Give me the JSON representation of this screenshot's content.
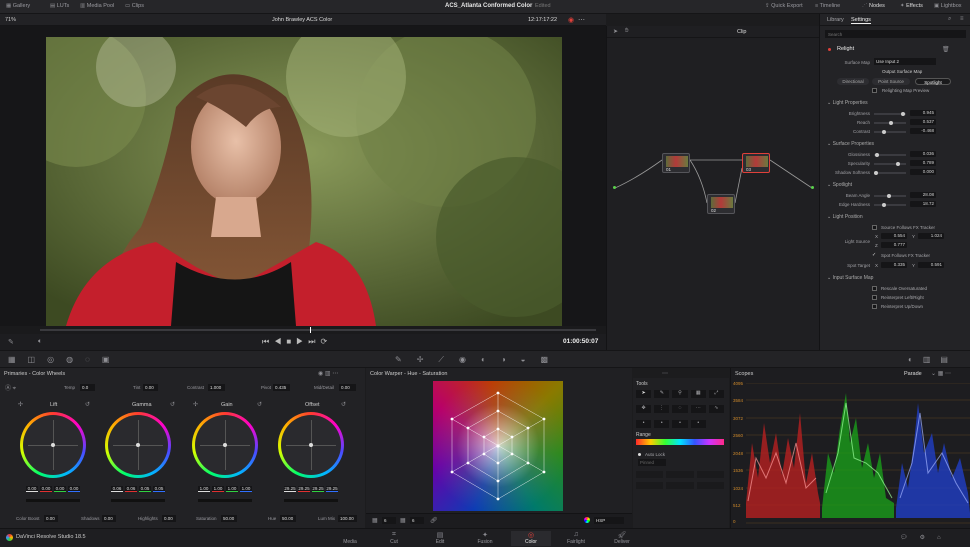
{
  "topbar": {
    "gallery": "Gallery",
    "luts": "LUTs",
    "media_pool": "Media Pool",
    "clips": "Clips",
    "project_title": "ACS_Atlanta Conformed Color",
    "edited": "Edited",
    "quick_export": "Quick Export",
    "timeline": "Timeline",
    "nodes": "Nodes",
    "effects": "Effects",
    "lightbox": "Lightbox"
  },
  "viewer": {
    "zoom": "71%",
    "clip_name": "John Brawley ACS Color",
    "timecode": "12:17:17:22",
    "clip_mode": "Clip",
    "playhead_tc": "01:00:50:07"
  },
  "inspector": {
    "tab_library": "Library",
    "tab_settings": "Settings",
    "search_placeholder": "Search",
    "effect_name": "Relight",
    "surface_map_label": "Surface Map",
    "surface_map_value": "Use Input 2",
    "output_surface_map": "Output Surface Map",
    "mode_directional": "Directional",
    "mode_point": "Point Source",
    "mode_spotlight": "Spotlight",
    "relighting_preview": "Relighting Map Preview",
    "light_properties": "Light Properties",
    "brightness_label": "Brightness",
    "brightness": "0.945",
    "brightness_pct": 0.95,
    "reach_label": "Reach",
    "reach": "0.537",
    "reach_pct": 0.54,
    "contrast_label": "Contrast",
    "contrast": "-0.468",
    "contrast_pct": 0.27,
    "surface_properties": "Surface Properties",
    "glossiness_label": "Glossiness",
    "glossiness": "0.036",
    "glossiness_pct": 0.04,
    "specularity_label": "Specularity",
    "specularity": "0.789",
    "specularity_pct": 0.79,
    "shadow_softness_label": "Shadow Softness",
    "shadow_softness": "0.000",
    "shadow_softness_pct": 0.0,
    "spotlight": "Spotlight",
    "beam_angle_label": "Beam Angle",
    "beam_angle": "28.08",
    "beam_angle_pct": 0.45,
    "edge_hardness_label": "Edge Hardness",
    "edge_hardness": "18.72",
    "edge_hardness_pct": 0.3,
    "light_position": "Light Position",
    "source_follows": "Source Follows FX Tracker",
    "light_source_label": "Light Source",
    "ls_x": "0.554",
    "ls_y": "1.024",
    "ls_z": "0.777",
    "spot_follows": "Spot Follows FX Tracker",
    "spot_target_label": "Spot Target",
    "st_x": "0.335",
    "st_y": "0.591",
    "input_surface_map": "Input Surface Map",
    "rescale": "Rescale Oversaturated",
    "reinterpret_lr": "Reinterpret Left/Right",
    "reinterpret_ud": "Reinterpret Up/Down",
    "x": "X",
    "y": "Y",
    "z": "Z"
  },
  "nodes": {
    "n01": "01",
    "n02": "02",
    "n03": "03"
  },
  "primaries": {
    "title": "Primaries - Color Wheels",
    "temp_label": "Temp",
    "temp": "0.0",
    "tint_label": "Tint",
    "tint": "0.00",
    "contrast_label": "Contrast",
    "contrast": "1.000",
    "pivot_label": "Pivot",
    "pivot": "0.435",
    "middetail_label": "Mid/Detail",
    "middetail": "0.00",
    "lift": "Lift",
    "lift_vals": [
      "0.00",
      "0.00",
      "0.00",
      "0.00"
    ],
    "gamma": "Gamma",
    "gamma_vals": [
      "0.06",
      "0.06",
      "0.05",
      "0.05"
    ],
    "gain": "Gain",
    "gain_vals": [
      "1.00",
      "1.00",
      "1.00",
      "1.00"
    ],
    "offset": "Offset",
    "offset_vals": [
      "29.25",
      "29.25",
      "29.25",
      "29.25"
    ],
    "color_boost_label": "Color Boost",
    "color_boost": "0.00",
    "shadows_label": "Shadows",
    "shadows": "0.00",
    "highlights_label": "Highlights",
    "highlights": "0.00",
    "saturation_label": "Saturation",
    "saturation": "50.00",
    "hue_label": "Hue",
    "hue": "50.00",
    "lummix_label": "Lum Mix",
    "lummix": "100.00"
  },
  "warper": {
    "title": "Color Warper - Hue - Saturation",
    "grid_a": "6",
    "grid_b": "6",
    "space": "HSP"
  },
  "tools": {
    "title": "Tools",
    "range": "Range",
    "auto_lock": "Auto Lock",
    "placeholder": "Pinned"
  },
  "scopes": {
    "title": "Scopes",
    "mode": "Parade",
    "ticks": [
      "4095",
      "3584",
      "3072",
      "2560",
      "2048",
      "1536",
      "1024",
      "512",
      "0"
    ]
  },
  "footer": {
    "brand": "DaVinci Resolve Studio 18.5",
    "pages": [
      "Media",
      "Cut",
      "Edit",
      "Fusion",
      "Color",
      "Fairlight",
      "Deliver"
    ],
    "active": "Color"
  },
  "colors": {
    "accent": "#e0403a",
    "active_page": "#e0403a",
    "bg": "#1c1c1e"
  }
}
